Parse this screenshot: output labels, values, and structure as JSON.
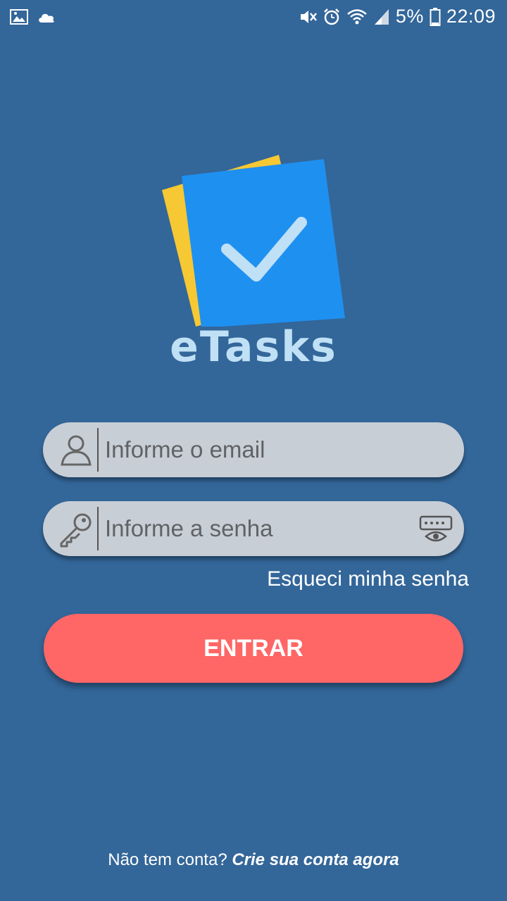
{
  "status_bar": {
    "battery_percent": "5%",
    "time": "22:09",
    "left_icons": [
      "image-icon",
      "cloud-icon"
    ],
    "right_icons": [
      "mute-icon",
      "alarm-icon",
      "wifi-icon",
      "signal-icon",
      "battery-icon"
    ]
  },
  "app": {
    "name": "eTasks",
    "colors": {
      "background": "#336699",
      "button": "#ff6666",
      "field": "#c8ced6",
      "logo_blue": "#1e90f0",
      "logo_yellow": "#f6c833"
    }
  },
  "login": {
    "email_placeholder": "Informe o email",
    "password_placeholder": "Informe a senha",
    "forgot_label": "Esqueci minha senha",
    "submit_label": "ENTRAR"
  },
  "signup": {
    "prompt": "Não tem conta?",
    "link_label": "Crie sua conta agora"
  }
}
